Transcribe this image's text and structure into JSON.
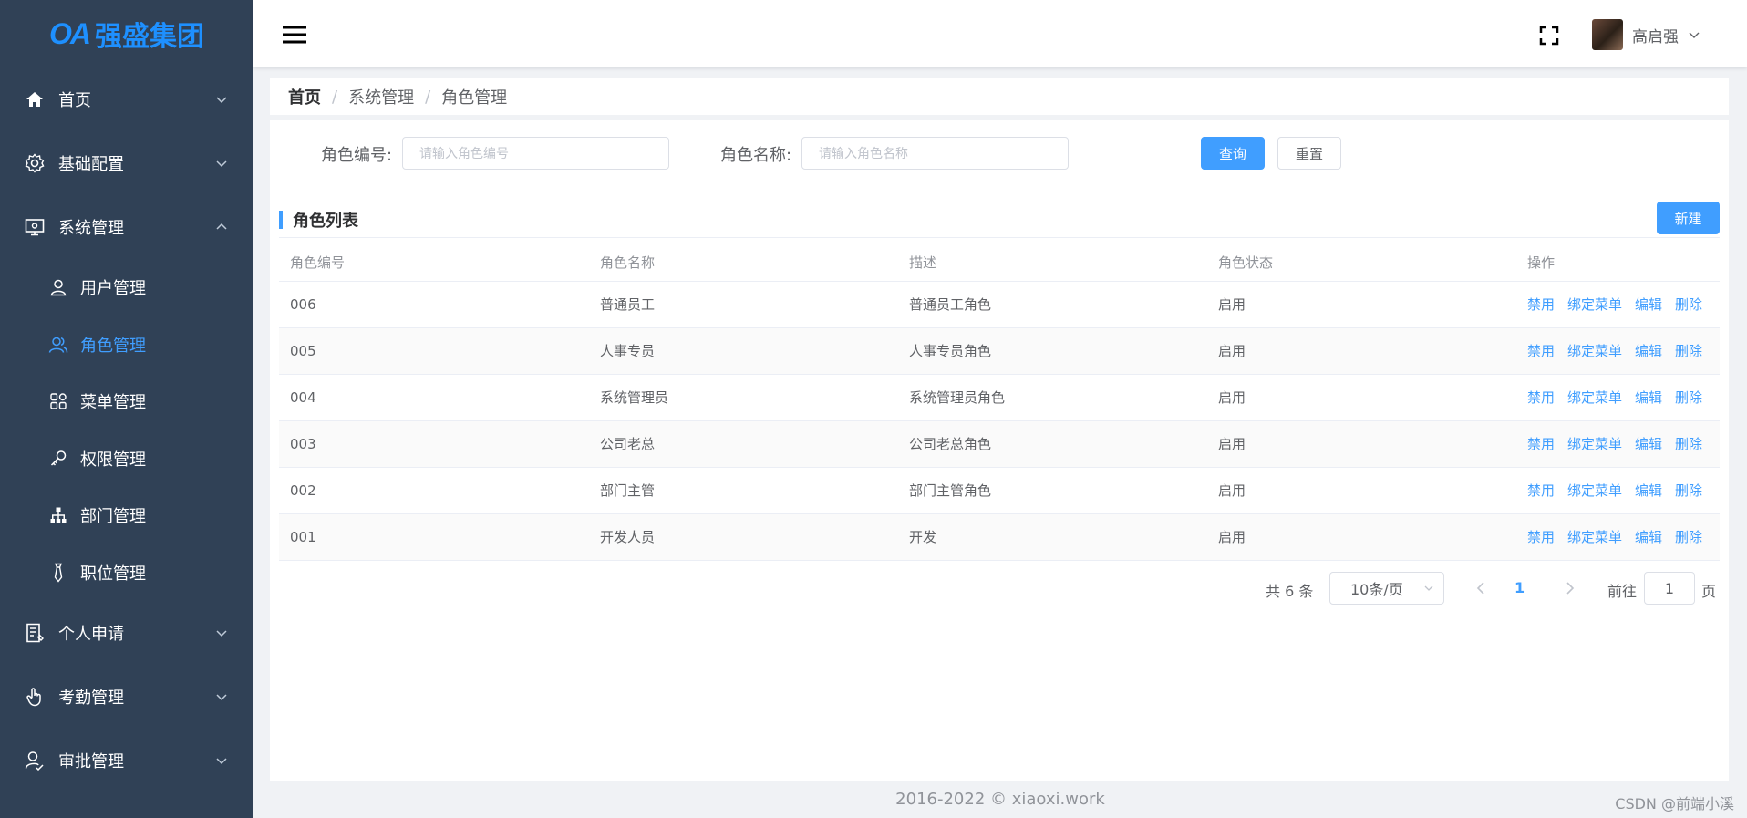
{
  "logo": {
    "oa": "OA",
    "name": "强盛集团"
  },
  "sidebar": {
    "items": [
      {
        "label": "首页"
      },
      {
        "label": "基础配置"
      },
      {
        "label": "系统管理"
      },
      {
        "label": "个人申请"
      },
      {
        "label": "考勤管理"
      },
      {
        "label": "审批管理"
      }
    ],
    "sub_items": [
      {
        "label": "用户管理"
      },
      {
        "label": "角色管理"
      },
      {
        "label": "菜单管理"
      },
      {
        "label": "权限管理"
      },
      {
        "label": "部门管理"
      },
      {
        "label": "职位管理"
      }
    ],
    "active_color": "#409eff",
    "background": "#304156"
  },
  "header": {
    "username": "高启强"
  },
  "breadcrumb": [
    "首页",
    "系统管理",
    "角色管理"
  ],
  "filters": {
    "role_code_label": "角色编号:",
    "role_code_placeholder": "请输入角色编号",
    "role_name_label": "角色名称:",
    "role_name_placeholder": "请输入角色名称",
    "search_label": "查询",
    "reset_label": "重置"
  },
  "list": {
    "title": "角色列表",
    "new_label": "新建",
    "columns": [
      "角色编号",
      "角色名称",
      "描述",
      "角色状态",
      "操作"
    ],
    "rows": [
      {
        "code": "006",
        "name": "普通员工",
        "desc": "普通员工角色",
        "status": "启用"
      },
      {
        "code": "005",
        "name": "人事专员",
        "desc": "人事专员角色",
        "status": "启用"
      },
      {
        "code": "004",
        "name": "系统管理员",
        "desc": "系统管理员角色",
        "status": "启用"
      },
      {
        "code": "003",
        "name": "公司老总",
        "desc": "公司老总角色",
        "status": "启用"
      },
      {
        "code": "002",
        "name": "部门主管",
        "desc": "部门主管角色",
        "status": "启用"
      },
      {
        "code": "001",
        "name": "开发人员",
        "desc": "开发",
        "status": "启用"
      }
    ],
    "actions": [
      "禁用",
      "绑定菜单",
      "编辑",
      "删除"
    ]
  },
  "pagination": {
    "total": "共 6 条",
    "page_size": "10条/页",
    "current_page": "1",
    "goto_label": "前往",
    "goto_value": "1",
    "goto_unit": "页"
  },
  "footer": {
    "copyright": "2016-2022 © xiaoxi.work",
    "watermark": "CSDN @前端小溪"
  },
  "colors": {
    "primary": "#409eff",
    "text": "#606266"
  }
}
